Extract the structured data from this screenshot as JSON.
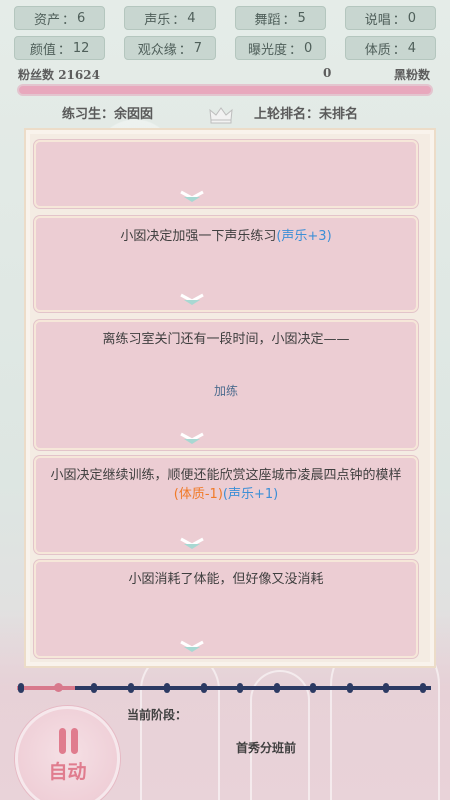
{
  "stats": [
    {
      "label": "资产",
      "value": "6"
    },
    {
      "label": "声乐",
      "value": "4"
    },
    {
      "label": "舞蹈",
      "value": "5"
    },
    {
      "label": "说唱",
      "value": "0"
    },
    {
      "label": "颜值",
      "value": "12"
    },
    {
      "label": "观众缘",
      "value": "7"
    },
    {
      "label": "曝光度",
      "value": "0"
    },
    {
      "label": "体质",
      "value": "4"
    }
  ],
  "stat_separator": "：",
  "fans": {
    "label": "粉丝数",
    "count": "21624",
    "black_count": "0",
    "black_label": "黑粉数",
    "bar_fraction": 1.0
  },
  "trainee": {
    "name_text": "练习生：余囡囡",
    "rank_text": "上轮排名：未排名"
  },
  "logs": [
    {
      "text": "",
      "choice": ""
    },
    {
      "text": "小囡决定加强一下声乐练习",
      "tags": [
        {
          "text": "(声乐+3)",
          "color": "blue"
        }
      ]
    },
    {
      "text": "离练习室关门还有一段时间，小囡决定——",
      "choice": "加练"
    },
    {
      "text": "小囡决定继续训练，顺便还能欣赏这座城市凌晨四点钟的模样",
      "tags": [
        {
          "text": "(体质-1)",
          "color": "orange"
        },
        {
          "text": "(声乐+1)",
          "color": "blue"
        }
      ]
    },
    {
      "text": "小囡消耗了体能，但好像又没消耗"
    }
  ],
  "progress": {
    "total_stops": 12,
    "current_index": 1
  },
  "stage": {
    "label": "当前阶段：",
    "value": "首秀分班前"
  },
  "auto_button": {
    "label": "自动",
    "icon": "pause-icon"
  },
  "colors": {
    "accent_pink": "#e07c8e",
    "tag_blue": "#3d8fd6",
    "tag_orange": "#f07a28",
    "track_navy": "#2c3a63"
  }
}
